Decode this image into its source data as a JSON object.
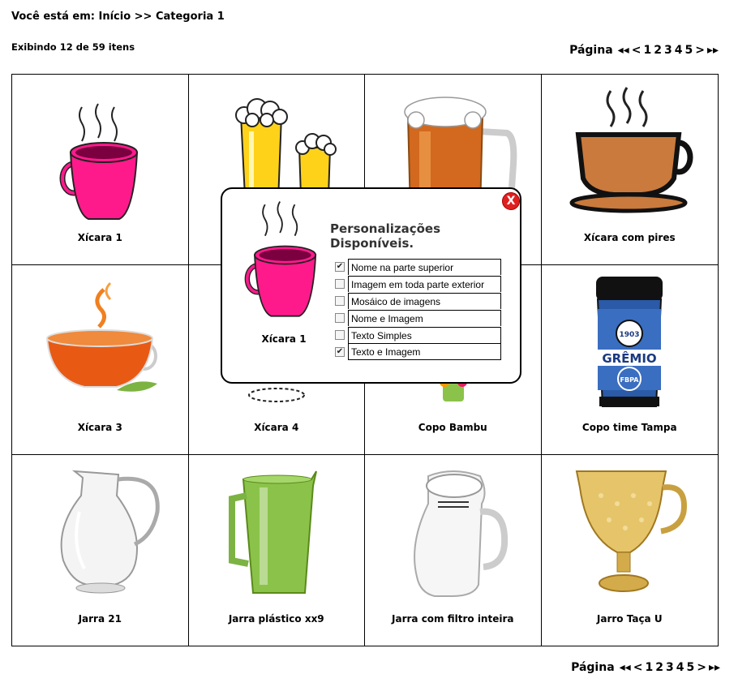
{
  "breadcrumb": "Você está em: Início >> Categoria 1",
  "count_text": "Exibindo 12 de 59 itens",
  "pager": {
    "label": "Página",
    "first": "◂◂",
    "prev": "<",
    "pages": [
      "1",
      "2",
      "3",
      "4",
      "5"
    ],
    "next": ">",
    "last": "▸▸"
  },
  "products": [
    {
      "name": "Xícara 1",
      "icon": "pink-cup-icon"
    },
    {
      "name": "",
      "icon": "beer-glasses-icon"
    },
    {
      "name": "",
      "icon": "beer-mug-icon"
    },
    {
      "name": "Xícara com pires",
      "icon": "cup-with-saucer-icon"
    },
    {
      "name": "Xícara 3",
      "icon": "tea-cup-icon"
    },
    {
      "name": "Xícara 4",
      "icon": "cup-icon"
    },
    {
      "name": "Copo Bambu",
      "icon": "bamboo-cup-icon"
    },
    {
      "name": "Copo time Tampa",
      "icon": "team-tumbler-icon"
    },
    {
      "name": "Jarra 21",
      "icon": "glass-pitcher-icon"
    },
    {
      "name": "Jarra plástico xx9",
      "icon": "green-pitcher-icon"
    },
    {
      "name": "Jarra com filtro inteira",
      "icon": "filter-pitcher-icon"
    },
    {
      "name": "Jarro Taça U",
      "icon": "gold-goblet-pitcher-icon"
    }
  ],
  "tumbler_text": {
    "number": "1903",
    "team": "GRÊMIO",
    "sub": "FBPA"
  },
  "modal": {
    "title": "Personalizações Disponíveis.",
    "close": "X",
    "product_name": "Xícara 1",
    "options": [
      {
        "label": "Nome na parte superior",
        "checked": true
      },
      {
        "label": "Imagem em toda parte exterior",
        "checked": false
      },
      {
        "label": "Mosáico de imagens",
        "checked": false
      },
      {
        "label": "Nome e Imagem",
        "checked": false
      },
      {
        "label": "Texto Simples",
        "checked": false
      },
      {
        "label": "Texto e Imagem",
        "checked": true
      }
    ]
  },
  "colors": {
    "pink": "#ff1a8c",
    "close": "#e02020",
    "coffee": "#c97a3c"
  }
}
